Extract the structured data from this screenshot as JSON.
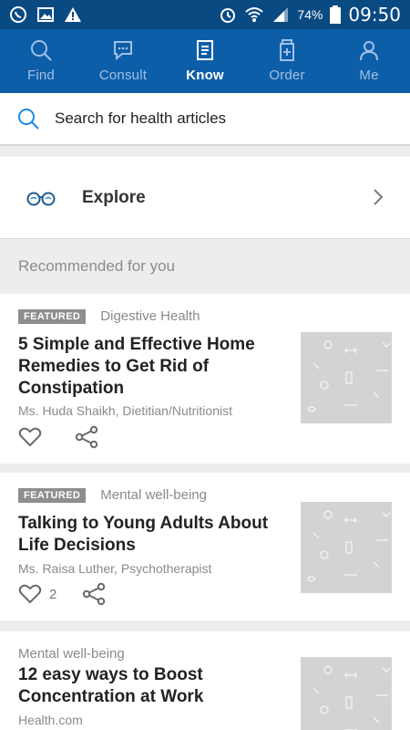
{
  "status": {
    "battery": "74%",
    "time": "09:50"
  },
  "nav": {
    "items": [
      {
        "label": "Find",
        "icon": "search-icon"
      },
      {
        "label": "Consult",
        "icon": "chat-icon"
      },
      {
        "label": "Know",
        "icon": "article-icon"
      },
      {
        "label": "Order",
        "icon": "medicine-bottle-icon"
      },
      {
        "label": "Me",
        "icon": "person-icon"
      }
    ],
    "active": "Know"
  },
  "search": {
    "placeholder": "Search for health articles"
  },
  "explore": {
    "label": "Explore"
  },
  "section": {
    "title": "Recommended for you"
  },
  "articles": [
    {
      "badge": "FEATURED",
      "category": "Digestive Health",
      "title": "5 Simple and Effective Home Remedies to Get Rid of Constipation",
      "author": "Ms. Huda Shaikh, Dietitian/Nutritionist",
      "likes": ""
    },
    {
      "badge": "FEATURED",
      "category": "Mental well-being",
      "title": "Talking to Young Adults About Life Decisions",
      "author": "Ms. Raisa Luther, Psychotherapist",
      "likes": "2"
    },
    {
      "badge": "",
      "category": "Mental well-being",
      "title": "12 easy ways to  Boost Concentration at Work",
      "author": "Health.com",
      "likes": ""
    }
  ],
  "colors": {
    "nav_bg": "#0d5ea8",
    "status_bg": "#0a4a83",
    "accent": "#1e88e5"
  }
}
